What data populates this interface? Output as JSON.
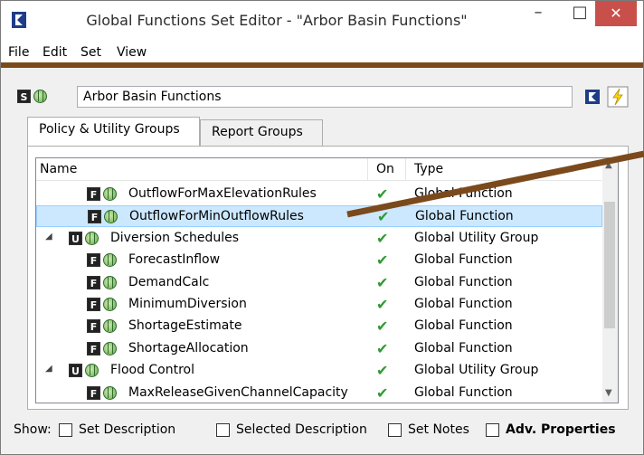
{
  "window": {
    "title": "Global Functions Set Editor - \"Arbor Basin Functions\"",
    "minimize": "–",
    "maximize": "□",
    "close": "✕"
  },
  "menu": [
    "File",
    "Edit",
    "Set",
    "View"
  ],
  "set_name": {
    "value": "Arbor Basin Functions",
    "badge": "S"
  },
  "tabs": [
    "Policy & Utility Groups",
    "Report Groups"
  ],
  "columns": {
    "name": "Name",
    "on": "On",
    "type": "Type"
  },
  "rows": [
    {
      "label": "OutflowForMaxElevationRules",
      "badge": "F",
      "on": "✔",
      "type": "Global Function",
      "selected": false
    },
    {
      "label": "OutflowForMinOutflowRules",
      "badge": "F",
      "on": "✔",
      "type": "Global Function",
      "selected": true
    },
    {
      "label": "Diversion Schedules",
      "badge": "U",
      "on": "✔",
      "type": "Global Utility Group",
      "selected": false,
      "expander": "◢"
    },
    {
      "label": "ForecastInflow",
      "badge": "F",
      "on": "✔",
      "type": "Global Function",
      "selected": false
    },
    {
      "label": "DemandCalc",
      "badge": "F",
      "on": "✔",
      "type": "Global Function",
      "selected": false
    },
    {
      "label": "MinimumDiversion",
      "badge": "F",
      "on": "✔",
      "type": "Global Function",
      "selected": false
    },
    {
      "label": "ShortageEstimate",
      "badge": "F",
      "on": "✔",
      "type": "Global Function",
      "selected": false
    },
    {
      "label": "ShortageAllocation",
      "badge": "F",
      "on": "✔",
      "type": "Global Function",
      "selected": false
    },
    {
      "label": "Flood Control",
      "badge": "U",
      "on": "✔",
      "type": "Global Utility Group",
      "selected": false,
      "expander": "◢"
    },
    {
      "label": "MaxReleaseGivenChannelCapacity",
      "badge": "F",
      "on": "✔",
      "type": "Global Function",
      "selected": false
    }
  ],
  "footer": {
    "show": "Show:",
    "set_description": "Set Description",
    "selected_description": "Selected Description",
    "set_notes": "Set Notes",
    "adv_properties": "Adv. Properties"
  },
  "colors": {
    "accent_bar": "#7b4a1c",
    "check": "#2e9b2e",
    "selection": "#cce8ff",
    "close": "#c9504a"
  }
}
